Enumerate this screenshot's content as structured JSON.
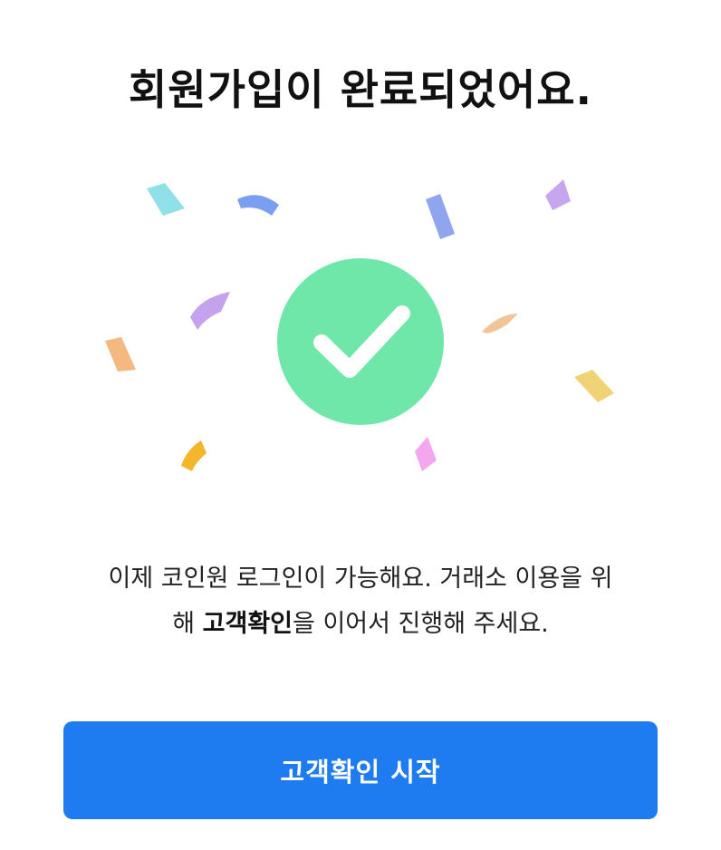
{
  "page": {
    "title": "회원가입이 완료되었어요."
  },
  "illustration": {
    "icon": "check-circle-icon",
    "check_color": "#6ee7a8",
    "confetti": "confetti"
  },
  "message": {
    "line1": "이제 코인원 로그인이 가능해요. 거래소 이용을 위",
    "line2_prefix": "해 ",
    "line2_emphasis": "고객확인",
    "line2_suffix": "을 이어서 진행해 주세요."
  },
  "cta": {
    "label": "고객확인 시작",
    "color": "#1f7bf0"
  }
}
